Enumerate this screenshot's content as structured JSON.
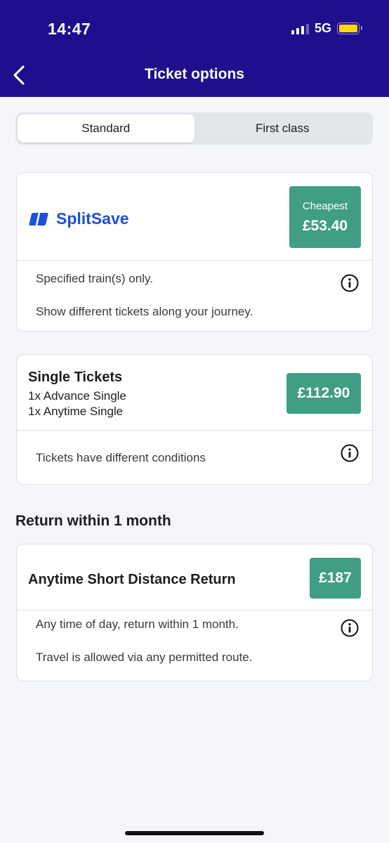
{
  "status_bar": {
    "time": "14:47",
    "network": "5G"
  },
  "header": {
    "title": "Ticket options",
    "back_icon": "chevron-left-icon"
  },
  "class_tabs": [
    {
      "label": "Standard",
      "selected": true
    },
    {
      "label": "First class",
      "selected": false
    }
  ],
  "splitsave": {
    "brand": "SplitSave",
    "badge": "Cheapest",
    "price": "£53.40",
    "conditions": [
      "Specified train(s) only.",
      "Show different tickets along your journey."
    ]
  },
  "single_tickets": {
    "title": "Single Tickets",
    "lines": [
      "1x Advance Single",
      "1x Anytime Single"
    ],
    "price": "£112.90",
    "conditions": [
      "Tickets have different conditions"
    ]
  },
  "return_section": {
    "heading": "Return within 1 month",
    "ticket_title": "Anytime Short Distance Return",
    "price": "£187",
    "conditions": [
      "Any time of day, return within 1 month.",
      "Travel is allowed via any permitted route."
    ]
  },
  "colors": {
    "header_bg": "#1e0f8c",
    "price_green": "#3f9e84",
    "splitsave_blue": "#1d4fd8",
    "battery": "#ffd60a"
  }
}
